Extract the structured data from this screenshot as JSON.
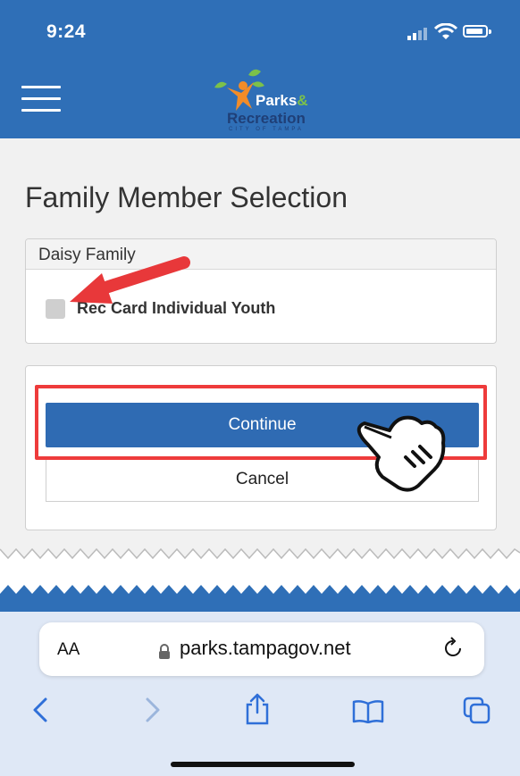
{
  "status_bar": {
    "time": "9:24"
  },
  "header": {
    "logo": {
      "line1": "Parks",
      "amp": "&",
      "line2": "Recreation",
      "tagline": "CITY OF TAMPA"
    }
  },
  "page": {
    "title": "Family Member Selection",
    "family_card": {
      "family_name": "Daisy Family",
      "member_label": "Rec Card Individual Youth",
      "checked": false
    },
    "buttons": {
      "continue": "Continue",
      "cancel": "Cancel"
    }
  },
  "browser": {
    "text_size_label": "AA",
    "url": "parks.tampagov.net"
  },
  "colors": {
    "brand_blue": "#2f6fb7",
    "button_blue": "#2f6bb3",
    "highlight_red": "#ee3b3b"
  },
  "icons": [
    "signal-icon",
    "wifi-icon",
    "battery-icon",
    "hamburger-menu-icon",
    "lock-icon",
    "reload-icon",
    "back-icon",
    "forward-icon",
    "share-icon",
    "bookmarks-icon",
    "tabs-icon",
    "pointing-hand-icon",
    "red-arrow-annotation"
  ]
}
